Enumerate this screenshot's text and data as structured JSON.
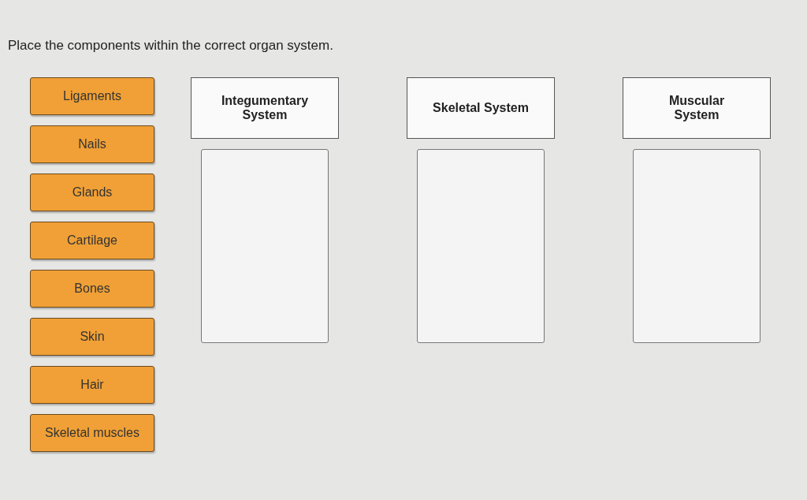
{
  "instruction": "Place the components within the correct organ system.",
  "components": [
    "Ligaments",
    "Nails",
    "Glands",
    "Cartilage",
    "Bones",
    "Skin",
    "Hair",
    "Skeletal muscles"
  ],
  "categories": [
    {
      "title": "Integumentary System"
    },
    {
      "title": "Skeletal System"
    },
    {
      "title": "Muscular System"
    }
  ]
}
